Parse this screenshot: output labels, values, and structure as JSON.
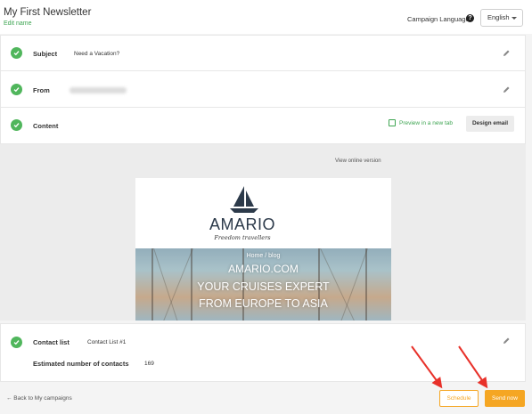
{
  "header": {
    "title": "My First Newsletter",
    "edit_link": "Edit name",
    "language_label": "Campaign Language",
    "language_value": "English"
  },
  "sections": {
    "subject": {
      "label": "Subject",
      "value": "Need a Vacation?"
    },
    "from": {
      "label": "From"
    },
    "content": {
      "label": "Content",
      "preview_link": "Preview in a new tab",
      "design_button": "Design email"
    }
  },
  "email_preview": {
    "view_online": "View online version",
    "brand": "AMARIO",
    "tagline": "Freedom travellers",
    "breadcrumb": "Home / blog",
    "site": "AMARIO.COM",
    "headline_1": "YOUR CRUISES EXPERT",
    "headline_2": "FROM EUROPE TO ASIA"
  },
  "contacts": {
    "label": "Contact list",
    "value": "Contact List #1",
    "estimate_label": "Estimated number of contacts",
    "estimate_value": "169"
  },
  "footer": {
    "back_link": "← Back to My campaigns",
    "schedule_button": "Schedule",
    "send_button": "Send now"
  },
  "colors": {
    "accent_green": "#3ea552",
    "check_green": "#50b65c",
    "action_orange": "#f5a623",
    "annotation_red": "#e8312a"
  }
}
